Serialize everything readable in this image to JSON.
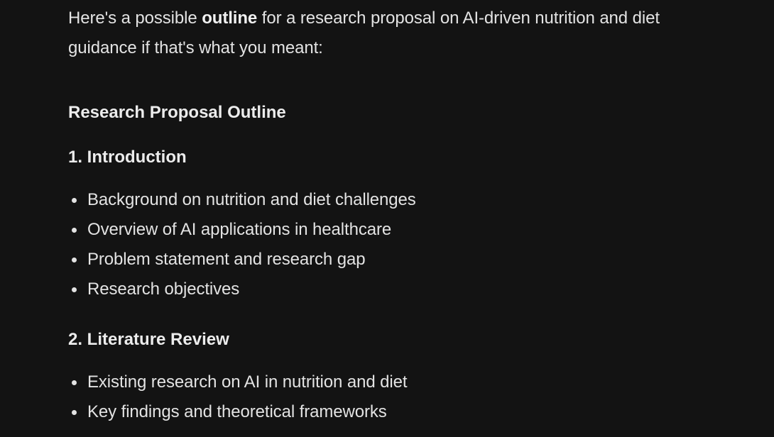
{
  "intro": {
    "prefix": "Here's a possible ",
    "bold": "outline",
    "suffix": " for a research proposal on AI-driven nutrition and diet guidance if that's what you meant:"
  },
  "outline": {
    "title": "Research Proposal Outline",
    "sections": [
      {
        "title": "1. Introduction",
        "items": [
          "Background on nutrition and diet challenges",
          "Overview of AI applications in healthcare",
          "Problem statement and research gap",
          "Research objectives"
        ]
      },
      {
        "title": "2. Literature Review",
        "items": [
          "Existing research on AI in nutrition and diet",
          "Key findings and theoretical frameworks"
        ]
      }
    ]
  }
}
